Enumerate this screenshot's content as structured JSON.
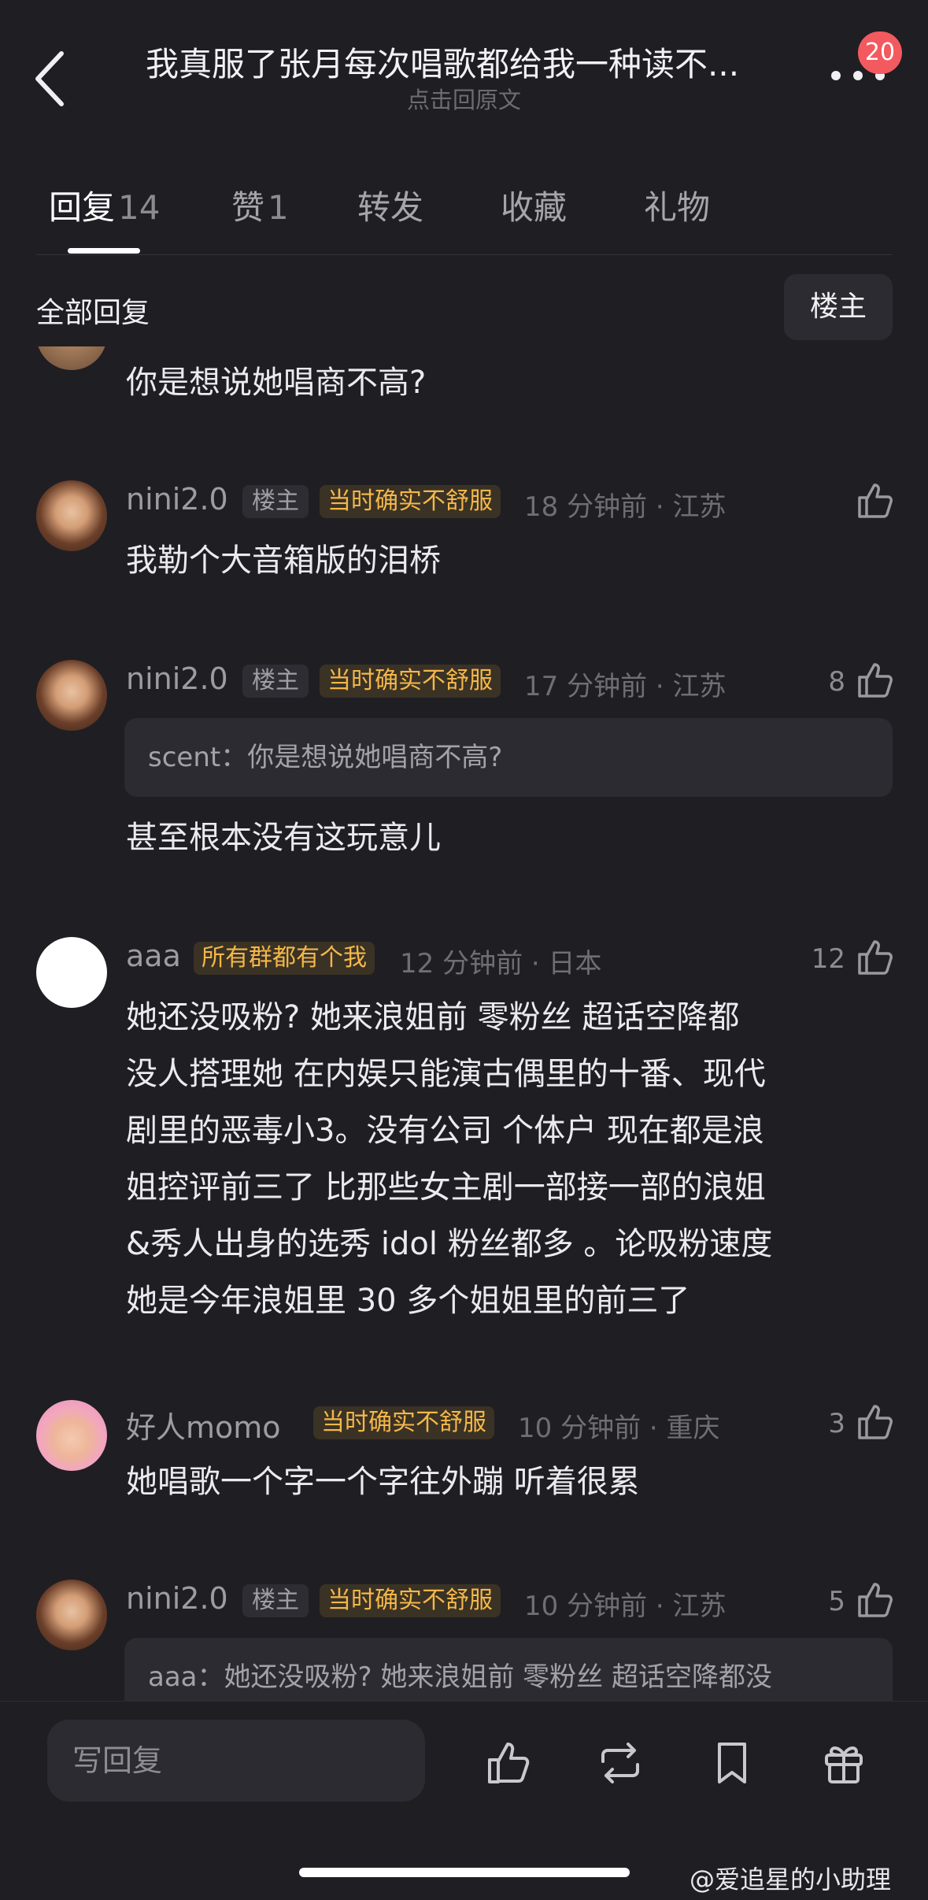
{
  "header": {
    "title": "我真服了张月每次唱歌都给我一种读不...",
    "subtitle": "点击回原文",
    "badge": "20"
  },
  "tabs": [
    {
      "label": "回复",
      "count": "14"
    },
    {
      "label": "赞",
      "count": "1"
    },
    {
      "label": "转发",
      "count": ""
    },
    {
      "label": "收藏",
      "count": ""
    },
    {
      "label": "礼物",
      "count": ""
    }
  ],
  "section": {
    "title": "全部回复",
    "owner_button": "楼主"
  },
  "comments": [
    {
      "body": "你是想说她唱商不高?"
    },
    {
      "name": "nini2.0",
      "owner_tag": "楼主",
      "gold_tag": "当时确实不舒服",
      "time": "18 分钟前 · 江苏",
      "likes": "",
      "body": "我勒个大音箱版的泪桥"
    },
    {
      "name": "nini2.0",
      "owner_tag": "楼主",
      "gold_tag": "当时确实不舒服",
      "time": "17 分钟前 · 江苏",
      "likes": "8",
      "quote": "scent：你是想说她唱商不高?",
      "body": "甚至根本没有这玩意儿"
    },
    {
      "name": "aaa",
      "gold_tag": "所有群都有个我",
      "time": "12 分钟前 · 日本",
      "likes": "12",
      "lines": [
        "她还没吸粉? 她来浪姐前 零粉丝 超话空降都",
        "没人搭理她 在内娱只能演古偶里的十番、现代",
        "剧里的恶毒小3。没有公司 个体户 现在都是浪",
        "姐控评前三了 比那些女主剧一部接一部的浪姐",
        "&秀人出身的选秀 idol 粉丝都多 。论吸粉速度",
        "她是今年浪姐里 30 多个姐姐里的前三了"
      ]
    },
    {
      "name": "好人momo",
      "gold_tag": "当时确实不舒服",
      "time": "10 分钟前 · 重庆",
      "likes": "3",
      "body": "她唱歌一个字一个字往外蹦 听着很累"
    },
    {
      "name": "nini2.0",
      "owner_tag": "楼主",
      "gold_tag": "当时确实不舒服",
      "time": "10 分钟前 · 江苏",
      "likes": "5",
      "quote": "aaa：她还没吸粉? 她来浪姐前 零粉丝 超话空降都没"
    }
  ],
  "bottom": {
    "input_placeholder": "写回复"
  },
  "watermark": "@爱追星的小助理"
}
